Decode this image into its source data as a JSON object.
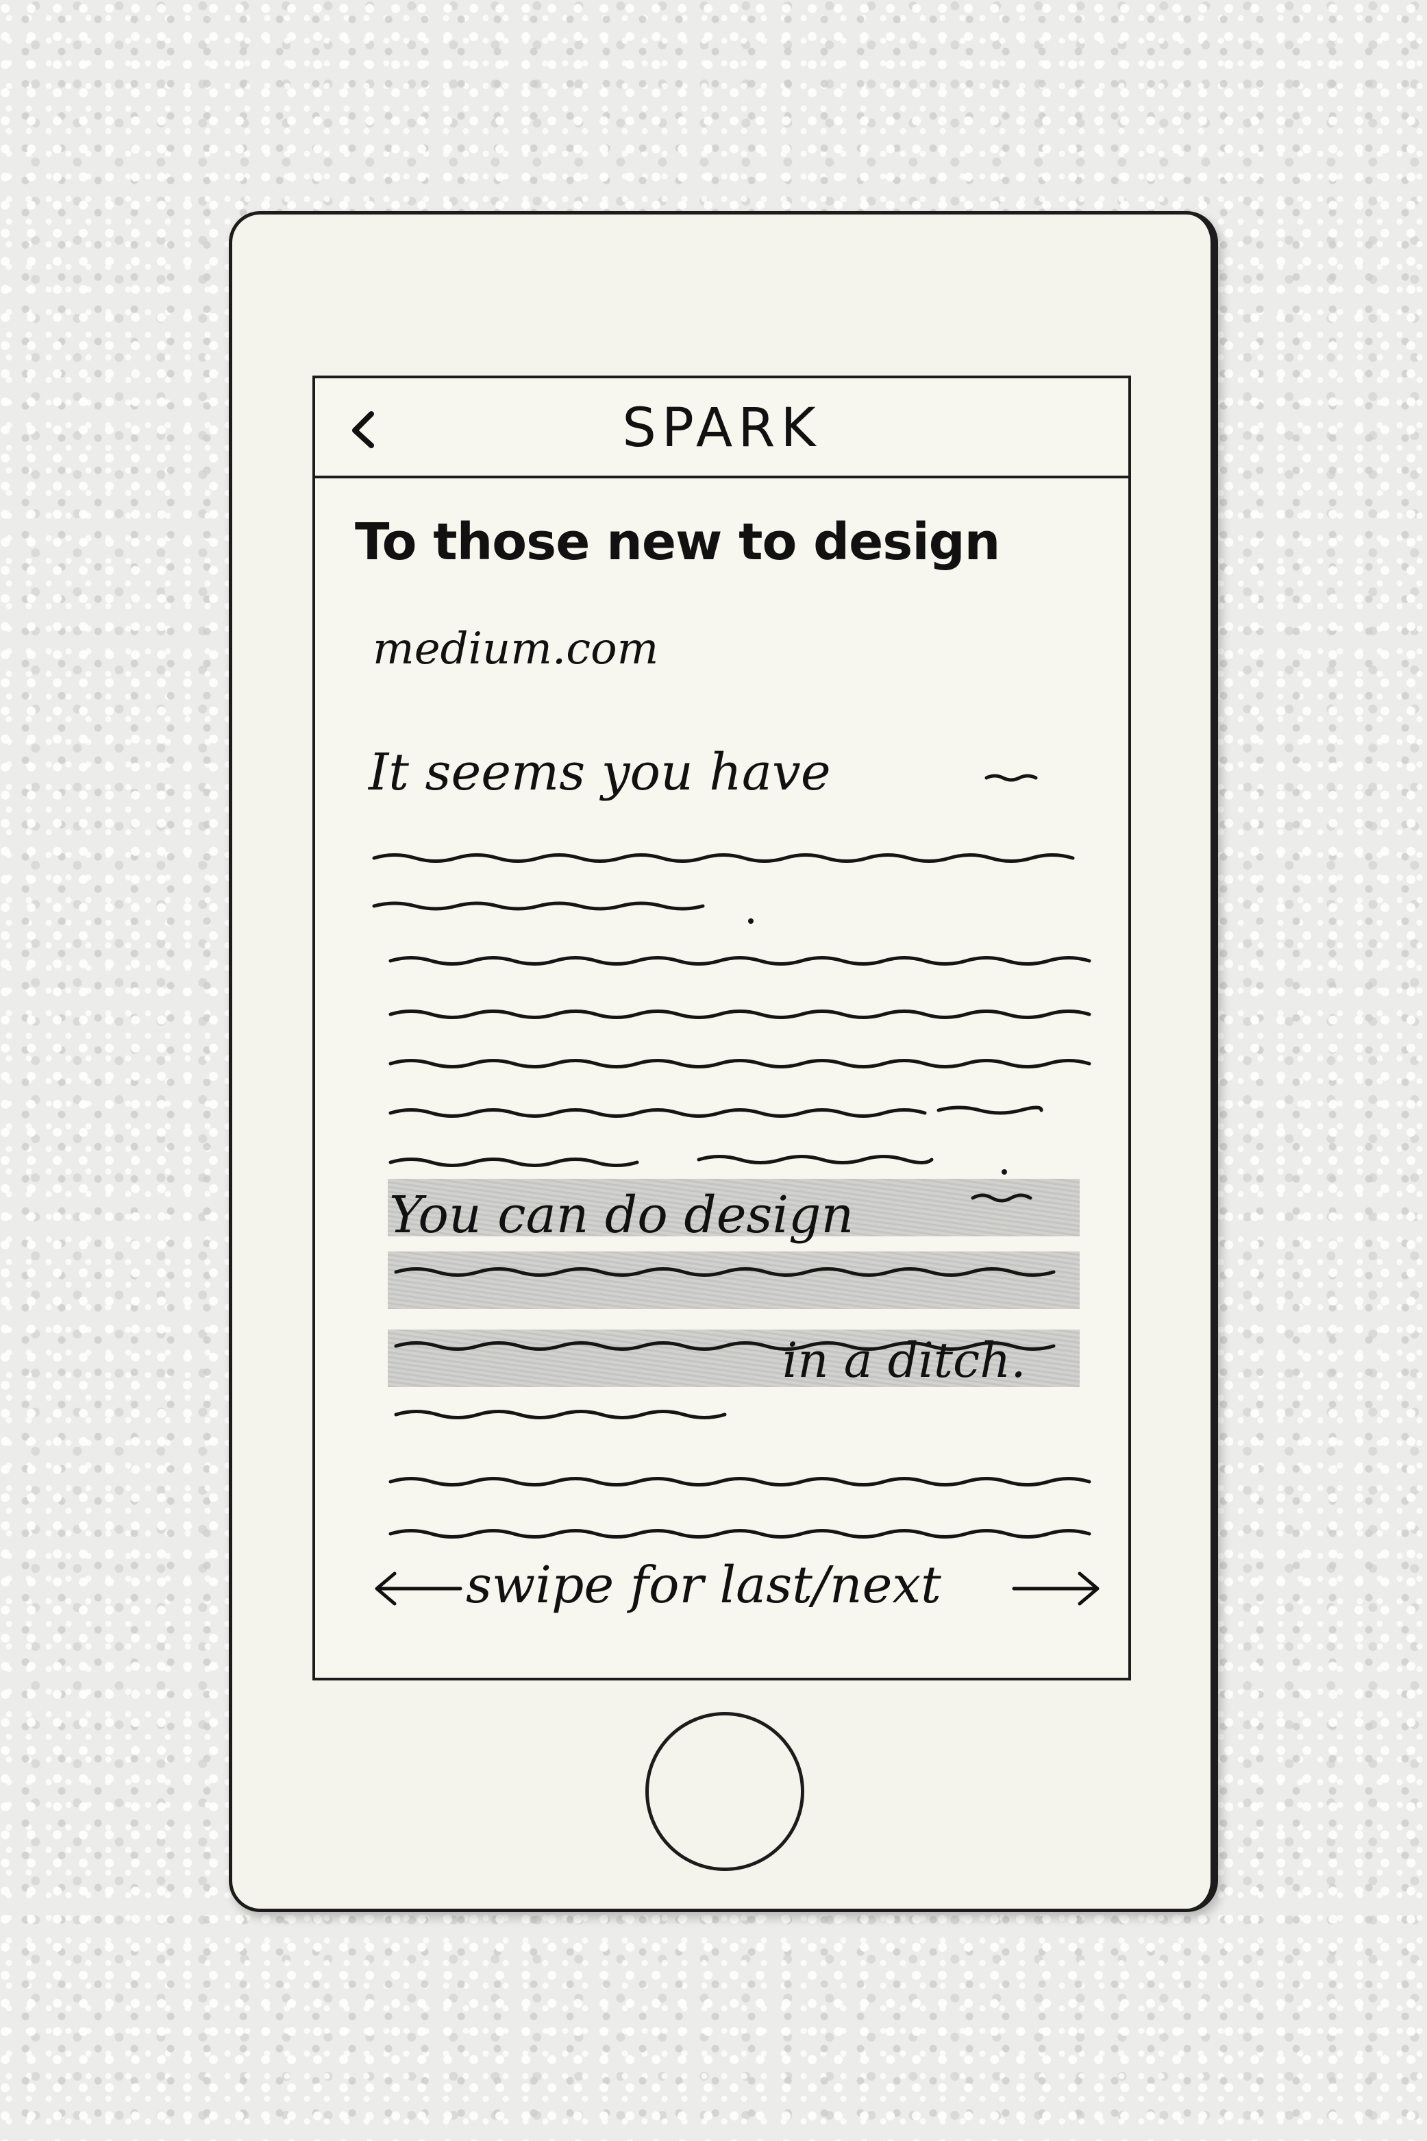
{
  "header": {
    "back_icon": "chevron-left-icon",
    "title": "SPARK"
  },
  "article": {
    "title": "To those new to design",
    "source": "medium.com",
    "paragraph1_start": "It seems you have",
    "paragraph2_start": "You can do design",
    "paragraph2_end": "in a ditch."
  },
  "footer": {
    "swipe_hint": "swipe for last/next",
    "left_icon": "arrow-left-icon",
    "right_icon": "arrow-right-icon"
  },
  "device": {
    "home_button_icon": "home-button-icon"
  },
  "colors": {
    "ink": "#1c1c1c",
    "paper": "#f5f4ec",
    "highlight": "#c9c9c6"
  }
}
